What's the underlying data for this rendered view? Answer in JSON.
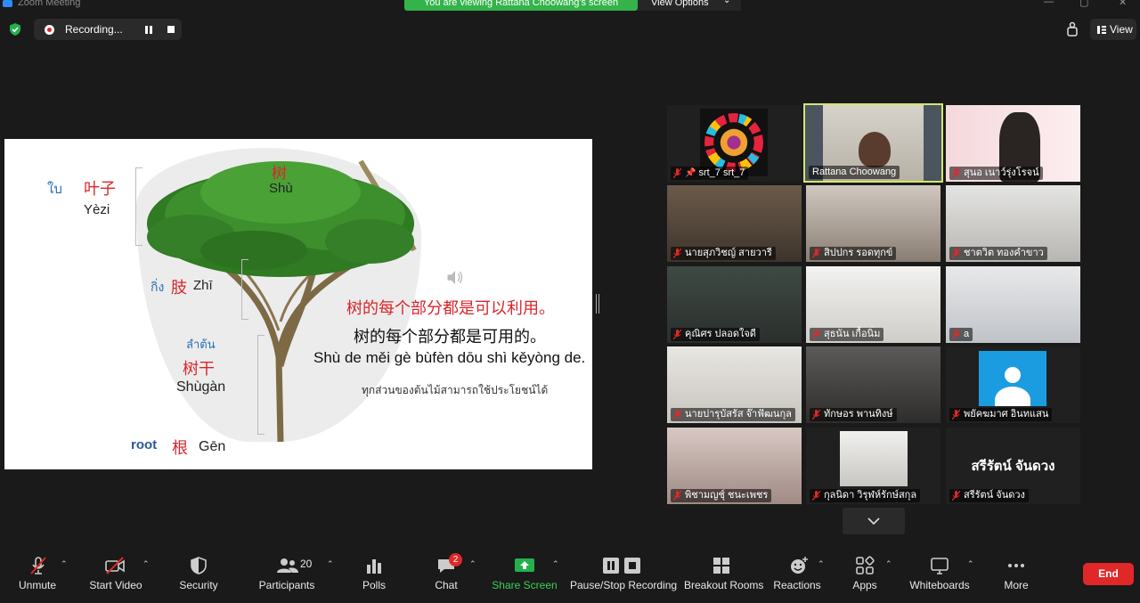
{
  "window": {
    "title": "Zoom Meeting"
  },
  "share_banner": "You are viewing Rattana Choowang's screen",
  "view_options": "View Options",
  "recording": {
    "label": "Recording..."
  },
  "view_button": "View",
  "slide": {
    "leaf": {
      "thai": "ใบ",
      "hanzi": "叶子",
      "pinyin": "Yèzi"
    },
    "tree": {
      "hanzi": "树",
      "pinyin": "Shù"
    },
    "branch": {
      "thai": "กิ่ง",
      "hanzi": "肢",
      "pinyin": "Zhī"
    },
    "trunk": {
      "thai": "ลำต้น",
      "hanzi": "树干",
      "pinyin": "Shùgàn"
    },
    "root": {
      "english": "root",
      "hanzi": "根",
      "pinyin": "Gēn"
    },
    "sentence_red": "树的每个部分都是可以利用。",
    "sentence_black": "树的每个部分都是可用的。",
    "sentence_pinyin": "Shù de měi gè bùfèn dōu shì kěyòng de.",
    "sentence_thai": "ทุกส่วนของต้นไม้สามารถใช้ประโยชน์ได้"
  },
  "participants": [
    {
      "name": "srt_7 srt_7",
      "pinned": true
    },
    {
      "name": "Rattana Choowang",
      "active": true
    },
    {
      "name": "สุนอ เนาว์รุ่งโรจน์"
    },
    {
      "name": "นายสุภวิชญ์ สายวารี"
    },
    {
      "name": "สิปปกร รอดทุกข์"
    },
    {
      "name": "ชาตวิต ทองคำขาว"
    },
    {
      "name": "คุณิศร ปลอดใจดี"
    },
    {
      "name": "สุธนัน เกื้อนิ่ม"
    },
    {
      "name": "a"
    },
    {
      "name": "นายปารุบัสรัส จ๊าฟัฒนกุล"
    },
    {
      "name": "ทักษอร พานทิงษ์"
    },
    {
      "name": "พยัคฆมาศ อินทแสน"
    },
    {
      "name": "พิชามญชุ์ ชนะเพชร"
    },
    {
      "name": "กุลนิดา วิรุฬห์รักษ์สกุล"
    },
    {
      "name": "สรีรัตน์ จันดวง",
      "big_name": "สรีรัตน์ จันดวง"
    }
  ],
  "toolbar": {
    "unmute": "Unmute",
    "start_video": "Start Video",
    "security": "Security",
    "participants": "Participants",
    "participants_count": "20",
    "polls": "Polls",
    "chat": "Chat",
    "chat_badge": "2",
    "share_screen": "Share Screen",
    "pause_stop_recording": "Pause/Stop Recording",
    "breakout_rooms": "Breakout Rooms",
    "reactions": "Reactions",
    "apps": "Apps",
    "whiteboards": "Whiteboards",
    "more": "More",
    "end": "End"
  },
  "colors": {
    "share_green": "#33b34a",
    "end_red": "#e02828",
    "active_border": "#d4e76a",
    "slide_red": "#d9262c",
    "slide_blue": "#2a6fb5"
  }
}
